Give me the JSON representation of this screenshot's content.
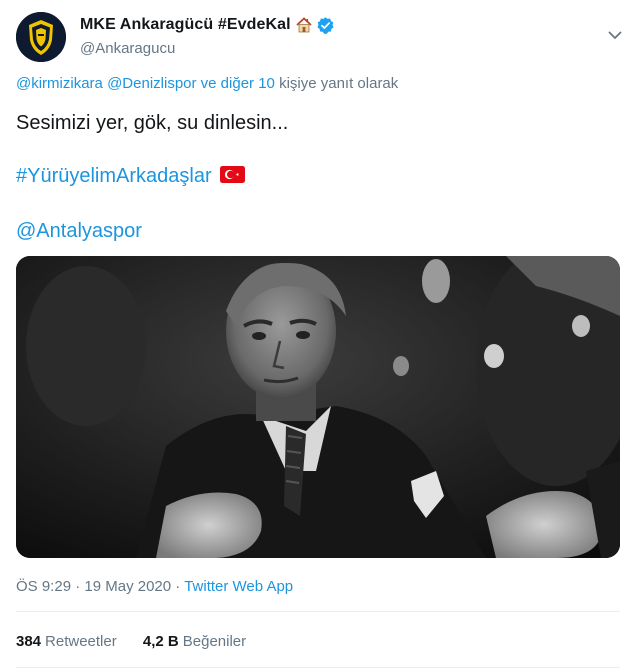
{
  "author": {
    "display_name": "MKE Ankaragücü #EvdeKal",
    "handle": "@Ankaragucu",
    "house_emoji": "house-icon",
    "verified": "verified-icon"
  },
  "reply": {
    "mention1": "@kirmizikara",
    "mention2": "@Denizlispor",
    "others_link": "ve diğer 10",
    "suffix": "kişiye yanıt olarak"
  },
  "tweet": {
    "line1": "Sesimizi yer, gök, su dinlesin...",
    "hashtag": "#YürüyelimArkadaşlar",
    "mention": "@Antalyaspor",
    "flag": "turkey-flag-icon"
  },
  "meta": {
    "time": "ÖS 9:29",
    "sep1": "·",
    "date": "19 May 2020",
    "sep2": "·",
    "source": "Twitter Web App"
  },
  "stats": {
    "retweets_count": "384",
    "retweets_label": "Retweetler",
    "likes_count": "4,2 B",
    "likes_label": "Beğeniler"
  },
  "colors": {
    "link": "#1b95e0",
    "secondary": "#657786",
    "verified": "#1da1f2",
    "avatar_bg": "#0d1a30",
    "avatar_accent": "#f2c300"
  }
}
